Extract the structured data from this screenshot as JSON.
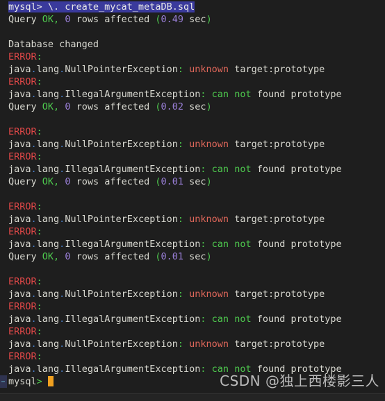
{
  "terminal": {
    "background_color": "#1e1e1e",
    "foreground_color": "#d8d8d0",
    "selection_color": "#3a3a9c",
    "cursor_color": "#f0a020",
    "accent_colors": {
      "green": "#4ec94e",
      "purple": "#9a7fd8",
      "red": "#e04848",
      "salmon": "#e0675a",
      "dot_blue": "#4a7fc8"
    },
    "prompt": "mysql>",
    "selected_command": "mysql> \\. create_mycat_metaDB.sql",
    "tokens": {
      "prompt_word": "mysql",
      "prompt_arrow": ">",
      "source_cmd": "\\. create_mycat_metaDB.sql",
      "query": "Query",
      "ok": "OK",
      "comma": ",",
      "zero": "0",
      "rows_affected": "rows affected",
      "paren_open": "(",
      "paren_close": ")",
      "sec": "sec",
      "database_changed": "Database changed",
      "error": "ERROR",
      "colon": ":",
      "java_lang": "java.lang",
      "dot": ".",
      "npe": "NullPointerException",
      "iae": "IllegalArgumentException",
      "unknown": "unknown",
      "target_prototype": "target:prototype",
      "can": "can",
      "not": "not",
      "found_prototype": "found prototype"
    },
    "timings": [
      "0.49",
      "0.02",
      "0.01",
      "0.01"
    ],
    "lines": [
      {
        "type": "selected_command",
        "text": "mysql> \\. create_mycat_metaDB.sql"
      },
      {
        "type": "query_ok",
        "text": "Query OK, 0 rows affected (0.49 sec)"
      },
      {
        "type": "blank",
        "text": ""
      },
      {
        "type": "plain",
        "text": "Database changed"
      },
      {
        "type": "error",
        "text": "ERROR:"
      },
      {
        "type": "npe",
        "text": "java.lang.NullPointerException: unknown target:prototype"
      },
      {
        "type": "error",
        "text": "ERROR:"
      },
      {
        "type": "iae",
        "text": "java.lang.IllegalArgumentException: can not found prototype"
      },
      {
        "type": "query_ok",
        "text": "Query OK, 0 rows affected (0.02 sec)"
      },
      {
        "type": "blank",
        "text": ""
      },
      {
        "type": "error",
        "text": "ERROR:"
      },
      {
        "type": "npe",
        "text": "java.lang.NullPointerException: unknown target:prototype"
      },
      {
        "type": "error",
        "text": "ERROR:"
      },
      {
        "type": "iae",
        "text": "java.lang.IllegalArgumentException: can not found prototype"
      },
      {
        "type": "query_ok",
        "text": "Query OK, 0 rows affected (0.01 sec)"
      },
      {
        "type": "blank",
        "text": ""
      },
      {
        "type": "error",
        "text": "ERROR:"
      },
      {
        "type": "npe",
        "text": "java.lang.NullPointerException: unknown target:prototype"
      },
      {
        "type": "error",
        "text": "ERROR:"
      },
      {
        "type": "iae",
        "text": "java.lang.IllegalArgumentException: can not found prototype"
      },
      {
        "type": "query_ok",
        "text": "Query OK, 0 rows affected (0.01 sec)"
      },
      {
        "type": "blank",
        "text": ""
      },
      {
        "type": "error",
        "text": "ERROR:"
      },
      {
        "type": "npe",
        "text": "java.lang.NullPointerException: unknown target:prototype"
      },
      {
        "type": "error",
        "text": "ERROR:"
      },
      {
        "type": "iae",
        "text": "java.lang.IllegalArgumentException: can not found prototype"
      },
      {
        "type": "error",
        "text": "ERROR:"
      },
      {
        "type": "npe",
        "text": "java.lang.NullPointerException: unknown target:prototype"
      },
      {
        "type": "error",
        "text": "ERROR:"
      },
      {
        "type": "iae",
        "text": "java.lang.IllegalArgumentException: can not found prototype"
      },
      {
        "type": "prompt",
        "text": "mysql>"
      }
    ]
  },
  "watermark": {
    "text": "CSDN @独上西楼影三人"
  }
}
